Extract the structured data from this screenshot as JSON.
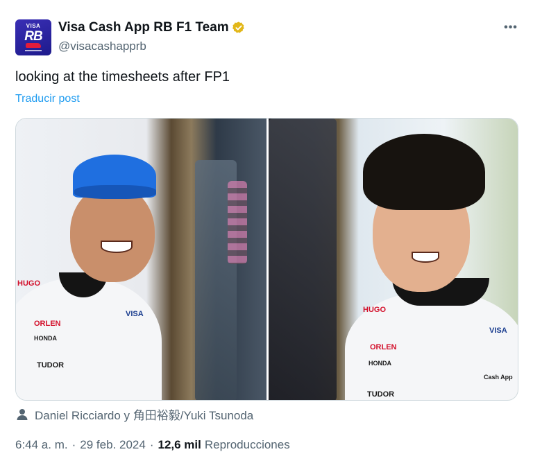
{
  "author": {
    "display_name": "Visa Cash App RB F1 Team",
    "handle": "@visacashapprb",
    "verified": true,
    "verified_color": "#e2b719",
    "avatar_text_top": "VISA",
    "avatar_text_mark": "RB"
  },
  "more_icon": "more-horizontal-icon",
  "more_glyph": "•••",
  "tweet": {
    "text": "looking at the timesheets after FP1",
    "translate_label": "Traducir post"
  },
  "media": {
    "images": [
      {
        "alt_subject": "Daniel Ricciardo",
        "shirt_brands": [
          "HUGO",
          "ORLEN",
          "HONDA",
          "TUDOR",
          "VISA"
        ]
      },
      {
        "alt_subject": "Yuki Tsunoda",
        "shirt_brands": [
          "HUGO",
          "ORLEN",
          "HONDA",
          "TUDOR",
          "VISA",
          "Cash App"
        ]
      }
    ]
  },
  "tagged": {
    "icon": "person-icon",
    "text": "Daniel Ricciardo y 角田裕毅/Yuki Tsunoda"
  },
  "meta": {
    "time": "6:44 a. m.",
    "separator": "·",
    "date": "29 feb. 2024",
    "views_count": "12,6 mil",
    "views_label": "Reproducciones"
  },
  "colors": {
    "link": "#1d9bf0",
    "secondary_text": "#536471",
    "primary_text": "#0f1419",
    "border": "#cfd9de"
  }
}
